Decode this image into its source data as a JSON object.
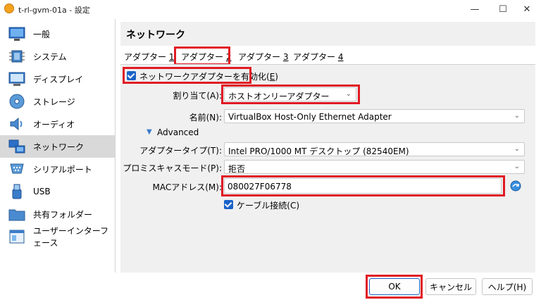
{
  "window": {
    "title": "t-rl-gvm-01a - 設定"
  },
  "sidebar": {
    "items": [
      {
        "label": "一般",
        "icon": "monitor-icon"
      },
      {
        "label": "システム",
        "icon": "chip-icon"
      },
      {
        "label": "ディスプレイ",
        "icon": "display-icon"
      },
      {
        "label": "ストレージ",
        "icon": "disk-icon"
      },
      {
        "label": "オーディオ",
        "icon": "speaker-icon"
      },
      {
        "label": "ネットワーク",
        "icon": "network-icon"
      },
      {
        "label": "シリアルポート",
        "icon": "serial-port-icon"
      },
      {
        "label": "USB",
        "icon": "usb-icon"
      },
      {
        "label": "共有フォルダー",
        "icon": "folder-icon"
      },
      {
        "label": "ユーザーインターフェース",
        "icon": "ui-icon"
      }
    ],
    "selected_index": 5
  },
  "page": {
    "title": "ネットワーク"
  },
  "tabs": [
    {
      "label": "アダプター ",
      "key": "1"
    },
    {
      "label": "アダプター ",
      "key": "2"
    },
    {
      "label": "アダプター ",
      "key": "3"
    },
    {
      "label": "アダプター ",
      "key": "4"
    }
  ],
  "adapter": {
    "enable_label": "ネットワークアダプターを有効化(",
    "enable_key": "E",
    "enable_suffix": ")",
    "enabled": true,
    "attached_label": "割り当て(A):",
    "attached_value": "ホストオンリーアダプター",
    "name_label": "名前(N):",
    "name_value": "VirtualBox Host-Only Ethernet Adapter",
    "advanced_label": "Advanced",
    "type_label": "アダプタータイプ(T):",
    "type_value": "Intel PRO/1000 MT デスクトップ (82540EM)",
    "promisc_label": "プロミスキャスモード(P):",
    "promisc_value": "拒否",
    "mac_label": "MACアドレス(M):",
    "mac_value": "080027F06778",
    "cable_label": "ケーブル接続(C)",
    "cable_connected": true
  },
  "footer": {
    "ok_label": "OK",
    "cancel_label": "キャンセル",
    "help_label": "ヘルプ(H)"
  },
  "colors": {
    "highlight": "#e01a24",
    "accent": "#1a63c7"
  }
}
